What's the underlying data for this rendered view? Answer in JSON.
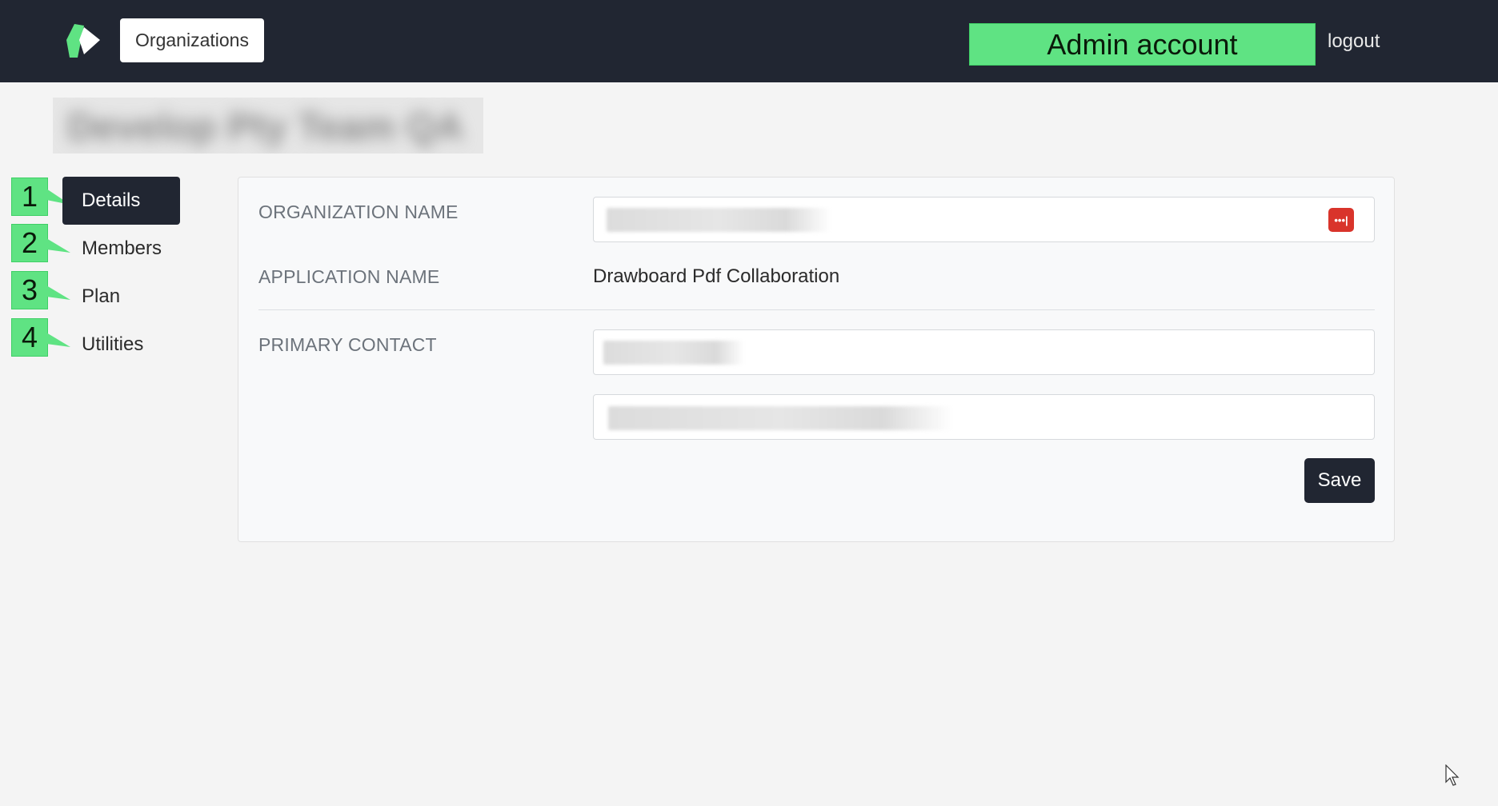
{
  "header": {
    "logo_icon": "drawboard-logo-icon",
    "organizations_label": "Organizations",
    "account_badge": "Admin account",
    "logout_label": "logout",
    "accent_color": "#5fe383",
    "bar_color": "#212632"
  },
  "page": {
    "title_redacted": "Develop Pty Team QA"
  },
  "sidebar": {
    "items": [
      {
        "marker": "1",
        "label": "Details",
        "active": true
      },
      {
        "marker": "2",
        "label": "Members",
        "active": false
      },
      {
        "marker": "3",
        "label": "Plan",
        "active": false
      },
      {
        "marker": "4",
        "label": "Utilities",
        "active": false
      }
    ]
  },
  "form": {
    "org_name_label": "ORGANIZATION NAME",
    "org_name_value": "",
    "password_manager_icon": "password-manager-icon",
    "app_name_label": "APPLICATION NAME",
    "app_name_value": "Drawboard Pdf Collaboration",
    "primary_contact_label": "PRIMARY CONTACT",
    "contact_name_value": "",
    "contact_email_value": "",
    "save_label": "Save"
  }
}
